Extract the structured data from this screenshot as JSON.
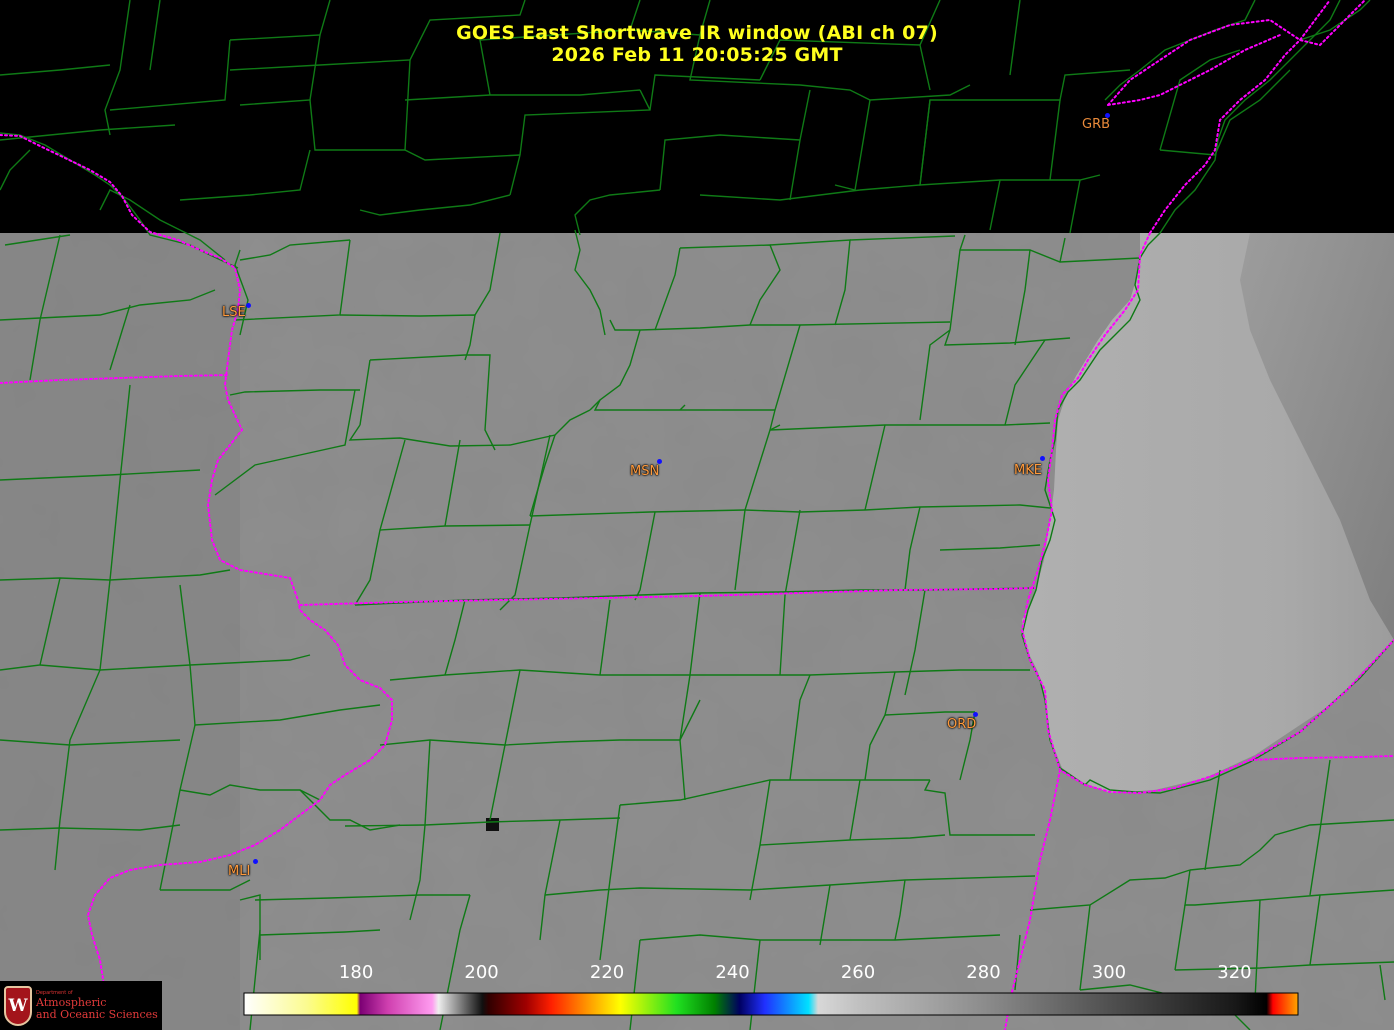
{
  "title": {
    "line1": "GOES East Shortwave IR window (ABI ch 07)",
    "line2": "2026 Feb 11  20:05:25 GMT"
  },
  "stations": [
    {
      "id": "GRB",
      "style": "on-dark"
    },
    {
      "id": "LSE",
      "style": "on-image"
    },
    {
      "id": "MSN",
      "style": "on-image"
    },
    {
      "id": "MKE",
      "style": "on-image"
    },
    {
      "id": "ORD",
      "style": "on-image"
    },
    {
      "id": "MLI",
      "style": "on-image"
    }
  ],
  "colorbar": {
    "ticks": [
      "180",
      "200",
      "220",
      "240",
      "260",
      "280",
      "300",
      "320"
    ],
    "min_value": 162,
    "max_value": 330,
    "stops": [
      {
        "value": 162,
        "color": "#ffffff"
      },
      {
        "value": 172,
        "color": "#fbfb90"
      },
      {
        "value": 180,
        "color": "#ffff00"
      },
      {
        "value": 180.5,
        "color": "#7c0074"
      },
      {
        "value": 185,
        "color": "#d040b0"
      },
      {
        "value": 192,
        "color": "#ff9cf0"
      },
      {
        "value": 193,
        "color": "#eeeeee"
      },
      {
        "value": 200,
        "color": "#101010"
      },
      {
        "value": 201,
        "color": "#300000"
      },
      {
        "value": 207,
        "color": "#a00000"
      },
      {
        "value": 211,
        "color": "#ff2000"
      },
      {
        "value": 217,
        "color": "#ff9c00"
      },
      {
        "value": 222,
        "color": "#ffff00"
      },
      {
        "value": 231,
        "color": "#20e020"
      },
      {
        "value": 237,
        "color": "#008000"
      },
      {
        "value": 241,
        "color": "#000060"
      },
      {
        "value": 245,
        "color": "#2030ff"
      },
      {
        "value": 252,
        "color": "#00e0ff"
      },
      {
        "value": 253.5,
        "color": "#d8d8d8"
      },
      {
        "value": 260,
        "color": "#c0c0c0"
      },
      {
        "value": 280,
        "color": "#8c8c8c"
      },
      {
        "value": 300,
        "color": "#505050"
      },
      {
        "value": 320,
        "color": "#181818"
      },
      {
        "value": 325,
        "color": "#000000"
      },
      {
        "value": 326,
        "color": "#ff0000"
      },
      {
        "value": 330,
        "color": "#ffa500"
      }
    ]
  },
  "colors": {
    "county_lines": "#0f7a16",
    "state_lines": "#ff00ff",
    "no_data": "#000000",
    "scene_gray": "#8a8a8a",
    "lake_gray": "#b0b0b0",
    "title": "#ffff1e",
    "station_label": "#ff9a3c",
    "station_dot": "#1010ff"
  },
  "logo": {
    "dept": "Department of",
    "name_line1": "Atmospheric",
    "name_line2": "and Oceanic Sciences"
  }
}
